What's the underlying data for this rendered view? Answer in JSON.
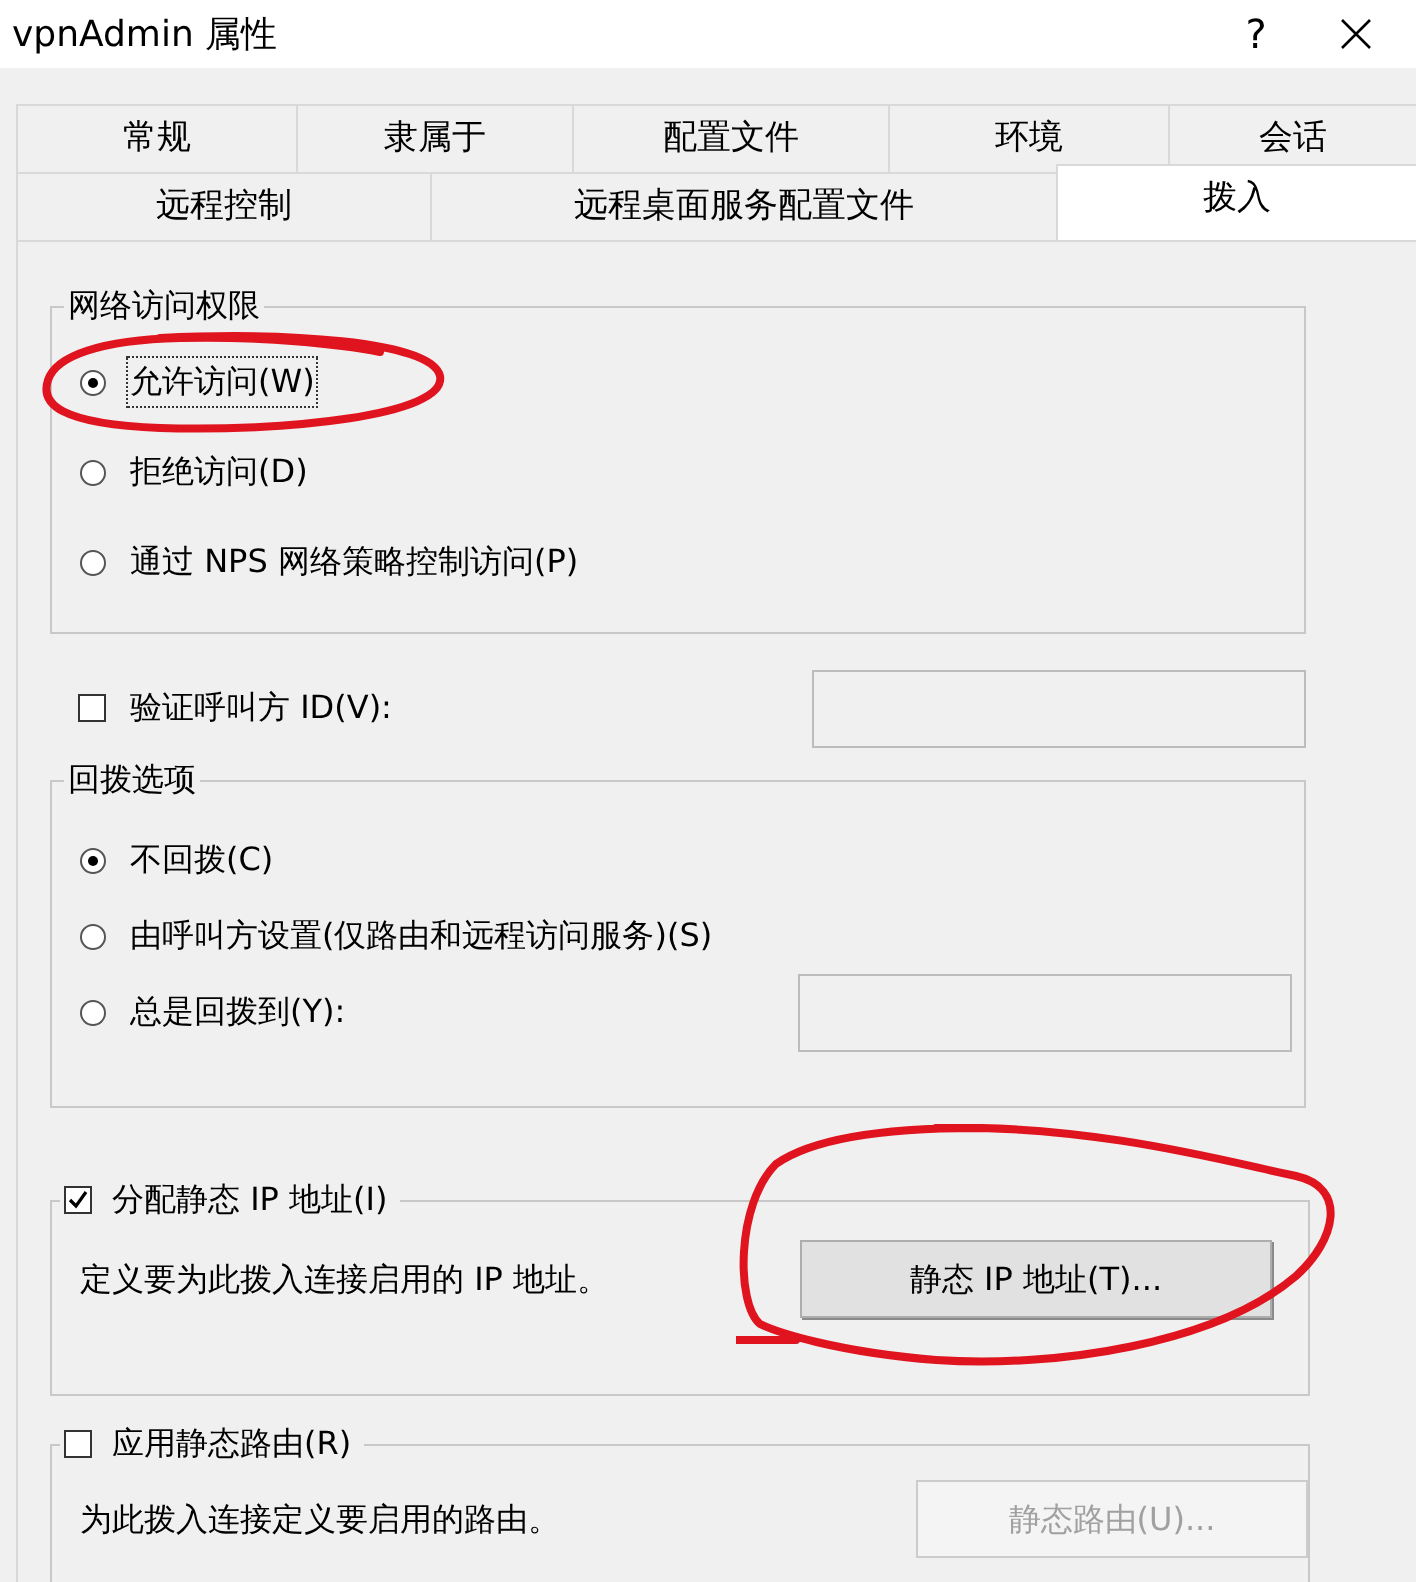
{
  "window": {
    "title": "vpnAdmin 属性",
    "help": "?"
  },
  "tab_rows": [
    [
      {
        "label": "常规",
        "selected": false
      },
      {
        "label": "隶属于",
        "selected": false
      },
      {
        "label": "配置文件",
        "selected": false
      },
      {
        "label": "环境",
        "selected": false
      },
      {
        "label": "会话",
        "selected": false
      }
    ],
    [
      {
        "label": "远程控制",
        "selected": false
      },
      {
        "label": "远程桌面服务配置文件",
        "selected": false
      },
      {
        "label": "拨入",
        "selected": true
      }
    ]
  ],
  "network_access": {
    "title": "网络访问权限",
    "options": [
      {
        "label": "允许访问(W)",
        "selected": true,
        "focused": true,
        "circled": true
      },
      {
        "label": "拒绝访问(D)",
        "selected": false,
        "focused": false
      },
      {
        "label": "通过 NPS 网络策略控制访问(P)",
        "selected": false,
        "focused": false
      }
    ]
  },
  "verify_caller": {
    "label": "验证呼叫方 ID(V):",
    "checked": false
  },
  "callback": {
    "title": "回拨选项",
    "options": [
      {
        "label": "不回拨(C)",
        "selected": true
      },
      {
        "label": "由呼叫方设置(仅路由和远程访问服务)(S)",
        "selected": false
      },
      {
        "label": "总是回拨到(Y):",
        "selected": false
      }
    ]
  },
  "static_ip": {
    "label": "分配静态 IP 地址(I)",
    "checked": true,
    "description": "定义要为此拨入连接启用的 IP 地址。",
    "button": {
      "label": "静态 IP 地址(T)...",
      "disabled": false,
      "circled": true
    }
  },
  "static_routes": {
    "label": "应用静态路由(R)",
    "checked": false,
    "description": "为此拨入连接定义要启用的路由。",
    "button": {
      "label": "静态路由(U)...",
      "disabled": true
    }
  }
}
